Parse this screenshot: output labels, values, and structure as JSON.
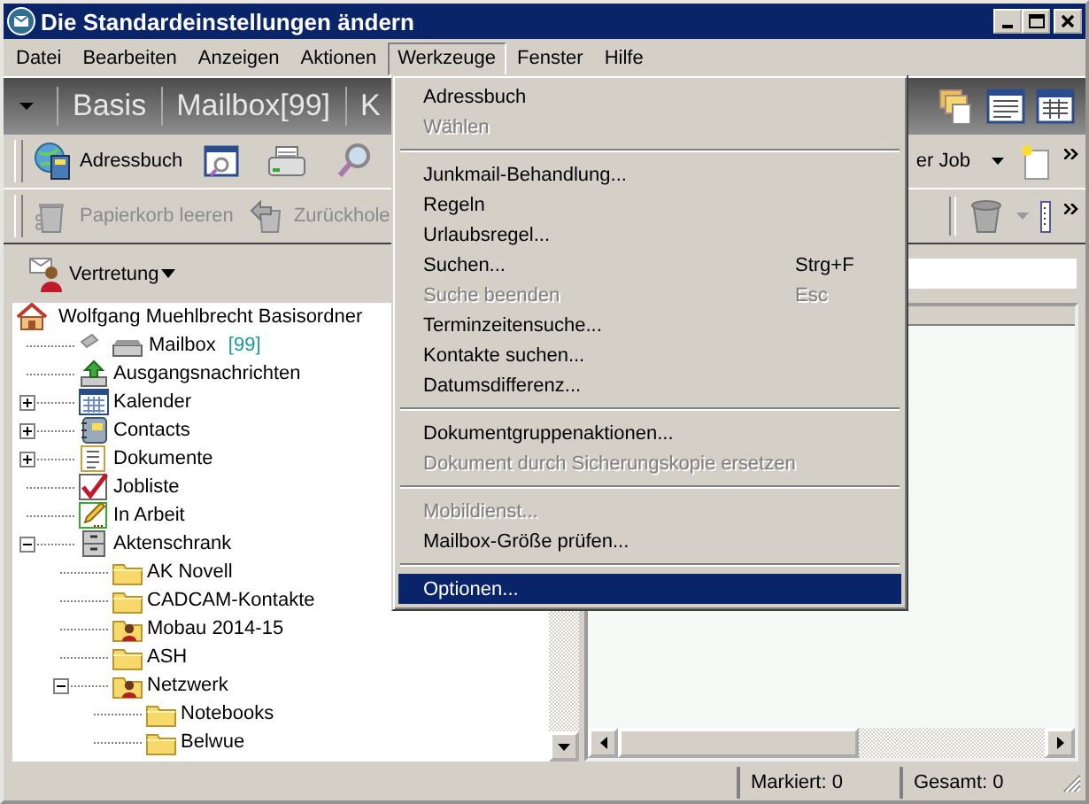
{
  "window": {
    "title": "Die Standardeinstellungen ändern"
  },
  "menubar": [
    {
      "label": "Datei",
      "selected": false
    },
    {
      "label": "Bearbeiten",
      "selected": false
    },
    {
      "label": "Anzeigen",
      "selected": false
    },
    {
      "label": "Aktionen",
      "selected": false
    },
    {
      "label": "Werkzeuge",
      "selected": true
    },
    {
      "label": "Fenster",
      "selected": false
    },
    {
      "label": "Hilfe",
      "selected": false
    }
  ],
  "nav_strip": {
    "tabs": [
      "Basis",
      "Mailbox[99]",
      "K"
    ]
  },
  "toolbar": {
    "rows": [
      {
        "left": [
          {
            "label": "Adressbuch",
            "disabled": false
          }
        ],
        "right": [
          {
            "label": "er Job",
            "disabled": false
          }
        ]
      },
      {
        "left": [
          {
            "label": "Papierkorb leeren",
            "disabled": true
          },
          {
            "label": "Zurückhole",
            "disabled": true
          }
        ],
        "right": []
      }
    ]
  },
  "deputy_button": {
    "label": "Vertretung"
  },
  "folder_tree": {
    "label": "Wolfgang Muehlbrecht Basisordner",
    "kind": "home",
    "children": [
      {
        "label": "Mailbox",
        "count": "[99]",
        "kind": "mailbox"
      },
      {
        "label": "Ausgangsnachrichten",
        "kind": "outbox"
      },
      {
        "label": "Kalender",
        "kind": "calendar",
        "expanded": false
      },
      {
        "label": "Contacts",
        "kind": "contacts",
        "expanded": false
      },
      {
        "label": "Dokumente",
        "kind": "documents",
        "expanded": false
      },
      {
        "label": "Jobliste",
        "kind": "checklist"
      },
      {
        "label": "In Arbeit",
        "kind": "pencil"
      },
      {
        "label": "Aktenschrank",
        "kind": "cabinet",
        "expanded": true,
        "children": [
          {
            "label": "AK Novell",
            "kind": "folder"
          },
          {
            "label": "CADCAM-Kontakte",
            "kind": "folder"
          },
          {
            "label": "Mobau 2014-15",
            "kind": "shared-folder"
          },
          {
            "label": "ASH",
            "kind": "folder"
          },
          {
            "label": "Netzwerk",
            "kind": "shared-folder",
            "expanded": true,
            "children": [
              {
                "label": "Notebooks",
                "kind": "folder"
              },
              {
                "label": "Belwue",
                "kind": "folder"
              }
            ]
          }
        ]
      }
    ]
  },
  "open_menu": {
    "items": [
      {
        "kind": "item",
        "label": "Adressbuch",
        "disabled": false,
        "selected": false
      },
      {
        "kind": "item",
        "label": "Wählen",
        "disabled": true,
        "selected": false
      },
      {
        "kind": "separator"
      },
      {
        "kind": "item",
        "label": "Junkmail-Behandlung...",
        "disabled": false,
        "selected": false
      },
      {
        "kind": "item",
        "label": "Regeln",
        "disabled": false,
        "selected": false
      },
      {
        "kind": "item",
        "label": "Urlaubsregel...",
        "disabled": false,
        "selected": false
      },
      {
        "kind": "item",
        "label": "Suchen...",
        "shortcut": "Strg+F",
        "disabled": false,
        "selected": false
      },
      {
        "kind": "item",
        "label": "Suche beenden",
        "shortcut": "Esc",
        "disabled": true,
        "selected": false
      },
      {
        "kind": "item",
        "label": "Terminzeitensuche...",
        "disabled": false,
        "selected": false
      },
      {
        "kind": "item",
        "label": "Kontakte suchen...",
        "disabled": false,
        "selected": false
      },
      {
        "kind": "item",
        "label": "Datumsdifferenz...",
        "disabled": false,
        "selected": false
      },
      {
        "kind": "separator"
      },
      {
        "kind": "item",
        "label": "Dokumentgruppenaktionen...",
        "disabled": false,
        "selected": false
      },
      {
        "kind": "item",
        "label": "Dokument durch Sicherungskopie ersetzen",
        "disabled": true,
        "selected": false
      },
      {
        "kind": "separator"
      },
      {
        "kind": "item",
        "label": "Mobildienst...",
        "disabled": true,
        "selected": false
      },
      {
        "kind": "item",
        "label": "Mailbox-Größe prüfen...",
        "disabled": false,
        "selected": false
      },
      {
        "kind": "separator"
      },
      {
        "kind": "item",
        "label": "Optionen...",
        "disabled": false,
        "selected": true
      }
    ]
  },
  "status_bar": {
    "panels": [
      "Markiert: 0",
      "Gesamt: 0"
    ]
  }
}
